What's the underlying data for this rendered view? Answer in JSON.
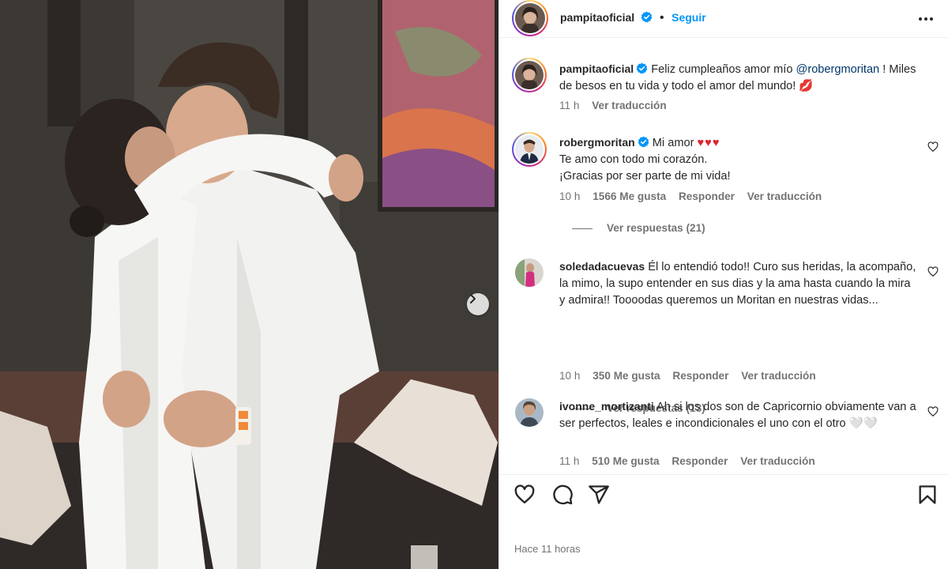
{
  "post": {
    "author": "pampitaoficial",
    "follow_label": "Seguir",
    "time_ago": "Hace 11 horas"
  },
  "caption": {
    "username": "pampitaoficial",
    "text_before": "Feliz cumpleaños amor mío ",
    "mention": "@robergmoritan",
    "text_after": " ! Miles de besos en tu vida y todo el amor del mundo! 💋",
    "time": "11 h",
    "translate": "Ver traducción"
  },
  "comments": [
    {
      "username": "robergmoritan",
      "verified": true,
      "text_line1": "Mi amor ",
      "hearts": "♥♥♥",
      "text_rest": [
        "Te amo con todo mi corazón.",
        "¡Gracias por ser parte de mi vida!"
      ],
      "time": "10 h",
      "likes": "1566 Me gusta",
      "reply": "Responder",
      "translate": "Ver traducción",
      "view_replies": "Ver respuestas (21)"
    },
    {
      "username": "soledadacuevas",
      "verified": false,
      "text": "Él lo entendió todo!! Curo sus heridas, la acompaño, la mimo, la supo entender en sus dias y la ama hasta cuando la mira y admira!! Toooodas queremos un Moritan en nuestras vidas...",
      "time": "10 h",
      "likes": "350 Me gusta",
      "reply": "Responder",
      "translate": "Ver traducción",
      "view_replies": "Ver respuestas (13)"
    },
    {
      "username": "ivonne_mortizanti",
      "verified": false,
      "text": "Ah si los dos son de Capricornio obviamente van a ser perfectos, leales e incondicionales el uno con el otro 🤍🤍",
      "time": "11 h",
      "likes": "510 Me gusta",
      "reply": "Responder",
      "translate": "Ver traducción"
    }
  ],
  "icons": {
    "verified": "verified-badge-icon",
    "more": "more-options-icon",
    "like": "heart-icon",
    "comment": "comment-icon",
    "share": "share-icon",
    "save": "bookmark-icon",
    "next": "chevron-right-icon"
  },
  "colors": {
    "accent": "#0095f6",
    "verified": "#0095f6",
    "text": "#262626",
    "muted": "#737373",
    "heart_red": "#d9262c",
    "mention": "#00376b"
  }
}
